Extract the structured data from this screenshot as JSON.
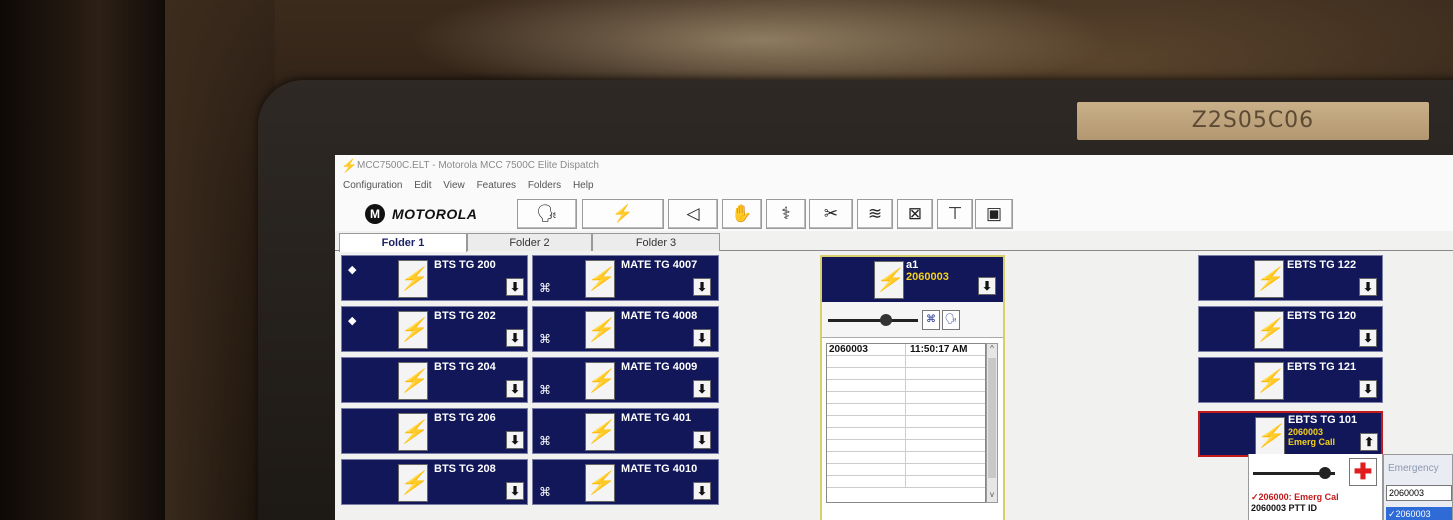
{
  "bezel_label": "Z2S05C06",
  "window": {
    "title": "MCC7500C.ELT - Motorola MCC 7500C Elite Dispatch"
  },
  "menu": [
    "Configuration",
    "Edit",
    "View",
    "Features",
    "Folders",
    "Help"
  ],
  "logo": {
    "mark": "M",
    "text": "MOTOROLA"
  },
  "toolbar": [
    {
      "name": "intercom-button",
      "glyph": "🗣"
    },
    {
      "name": "transmit-button",
      "glyph": "⚡"
    },
    {
      "name": "speaker-button",
      "glyph": "◁"
    },
    {
      "name": "monitor-button",
      "glyph": "✋"
    },
    {
      "name": "stethoscope-button",
      "glyph": "⚕"
    },
    {
      "name": "patch-disconnect-button",
      "glyph": "✂"
    },
    {
      "name": "page-button",
      "glyph": "≋"
    },
    {
      "name": "clear-button",
      "glyph": "⊠"
    },
    {
      "name": "network-button",
      "glyph": "⊤"
    },
    {
      "name": "display-button",
      "glyph": "▣"
    }
  ],
  "tabs": [
    "Folder 1",
    "Folder 2",
    "Folder 3"
  ],
  "left_tiles": [
    {
      "name": "BTS TG 200",
      "marker": "◆",
      "arrow": "⬇"
    },
    {
      "name": "BTS TG 202",
      "marker": "◆",
      "arrow": "⬇"
    },
    {
      "name": "BTS TG 204",
      "marker": "",
      "arrow": "⬇"
    },
    {
      "name": "BTS TG 206",
      "marker": "",
      "arrow": "⬇"
    },
    {
      "name": "BTS TG 208",
      "marker": "",
      "arrow": "⬇"
    }
  ],
  "mid_tiles": [
    {
      "name": "MATE TG 4007",
      "marker": "⌘",
      "arrow": "⬇"
    },
    {
      "name": "MATE TG 4008",
      "marker": "⌘",
      "arrow": "⬇"
    },
    {
      "name": "MATE TG 4009",
      "marker": "⌘",
      "arrow": "⬇"
    },
    {
      "name": "MATE TG 401",
      "marker": "⌘",
      "arrow": "⬇"
    },
    {
      "name": "MATE TG 4010",
      "marker": "⌘",
      "arrow": "⬇"
    }
  ],
  "selected": {
    "name": "a1",
    "id": "2060003",
    "arrow": "⬇",
    "log": [
      {
        "id": "2060003",
        "time": "11:50:17 AM"
      },
      {
        "id": "",
        "time": ""
      },
      {
        "id": "",
        "time": ""
      },
      {
        "id": "",
        "time": ""
      },
      {
        "id": "",
        "time": ""
      },
      {
        "id": "",
        "time": ""
      },
      {
        "id": "",
        "time": ""
      },
      {
        "id": "",
        "time": ""
      },
      {
        "id": "",
        "time": ""
      },
      {
        "id": "",
        "time": ""
      },
      {
        "id": "",
        "time": ""
      },
      {
        "id": "",
        "time": ""
      }
    ]
  },
  "right_tiles": [
    {
      "name": "EBTS TG 122",
      "arrow": "⬇"
    },
    {
      "name": "EBTS TG 120",
      "arrow": "⬇"
    },
    {
      "name": "EBTS TG 121",
      "arrow": "⬇"
    }
  ],
  "emergency_tile": {
    "name": "EBTS TG 101",
    "id": "2060003",
    "status": "Emerg Call",
    "arrow": "⬆",
    "log_line1": "✓206000: Emerg Cal",
    "log_line2": "2060003  PTT ID",
    "popup_title": "Emergency",
    "popup_field": "2060003",
    "popup_selected": "✓2060003"
  }
}
